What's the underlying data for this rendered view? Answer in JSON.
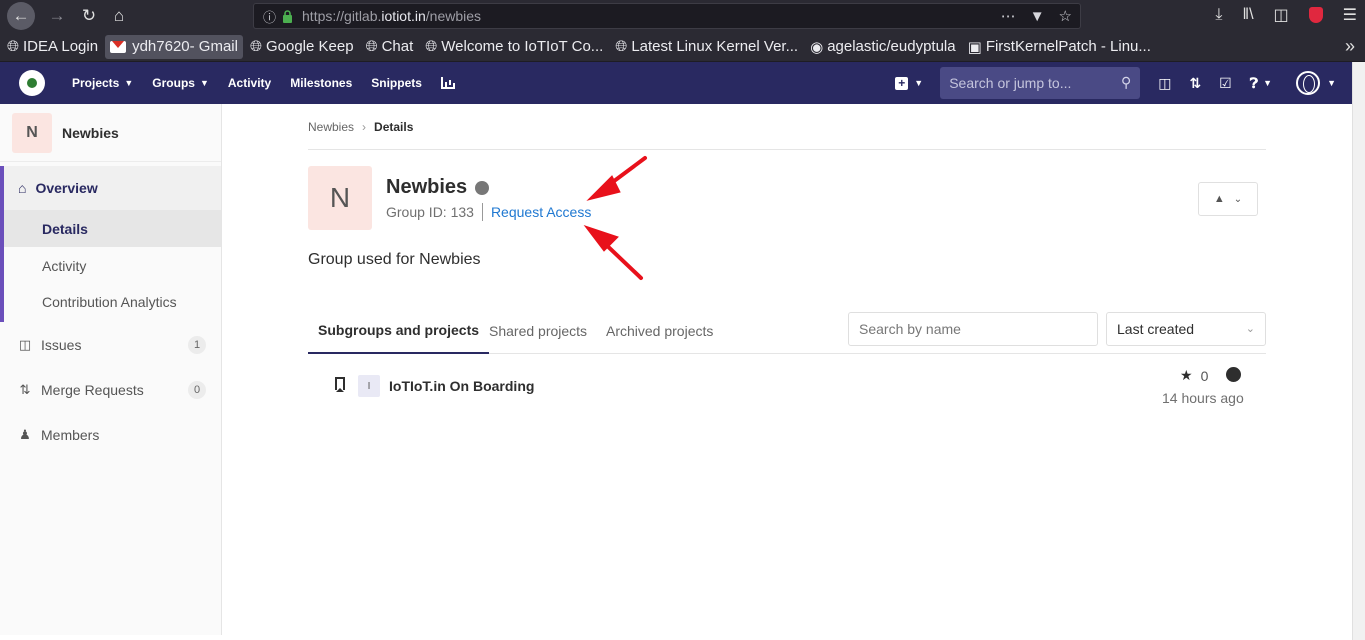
{
  "browser": {
    "url_prefix": "https://gitlab.",
    "url_domain": "iotiot.in",
    "url_path": "/newbies"
  },
  "bookmarks": [
    {
      "label": "IDEA Login",
      "icon": "globe-icon"
    },
    {
      "label": "ydh7620- Gmail",
      "icon": "gmail-icon"
    },
    {
      "label": "Google Keep",
      "icon": "globe-icon"
    },
    {
      "label": "Chat",
      "icon": "globe-icon"
    },
    {
      "label": "Welcome to IoTIoT Co...",
      "icon": "globe-icon"
    },
    {
      "label": "Latest Linux Kernel Ver...",
      "icon": "globe-icon"
    },
    {
      "label": "agelastic/eudyptula",
      "icon": "github-icon"
    },
    {
      "label": "FirstKernelPatch - Linu...",
      "icon": "site-icon"
    }
  ],
  "header": {
    "nav": [
      "Projects",
      "Groups",
      "Activity",
      "Milestones",
      "Snippets"
    ],
    "search_placeholder": "Search or jump to..."
  },
  "sidebar": {
    "group_initial": "N",
    "group_name": "Newbies",
    "overview": "Overview",
    "sub_items": [
      "Details",
      "Activity",
      "Contribution Analytics"
    ],
    "issues": {
      "label": "Issues",
      "count": "1"
    },
    "merge_requests": {
      "label": "Merge Requests",
      "count": "0"
    },
    "members": "Members"
  },
  "breadcrumb": {
    "parent": "Newbies",
    "current": "Details"
  },
  "group": {
    "initial": "N",
    "name": "Newbies",
    "id_text": "Group ID: 133",
    "request_access": "Request Access",
    "description": "Group used for Newbies"
  },
  "tabs": [
    "Subgroups and projects",
    "Shared projects",
    "Archived projects"
  ],
  "filter": {
    "placeholder": "Search by name",
    "sort_value": "Last created"
  },
  "project": {
    "initial": "I",
    "name": "IoTIoT.in On Boarding",
    "stars": "0",
    "updated": "14 hours ago"
  },
  "colors": {
    "header_bg": "#292961",
    "annotation_arrow": "#e8111b",
    "link": "#1f78d1"
  }
}
